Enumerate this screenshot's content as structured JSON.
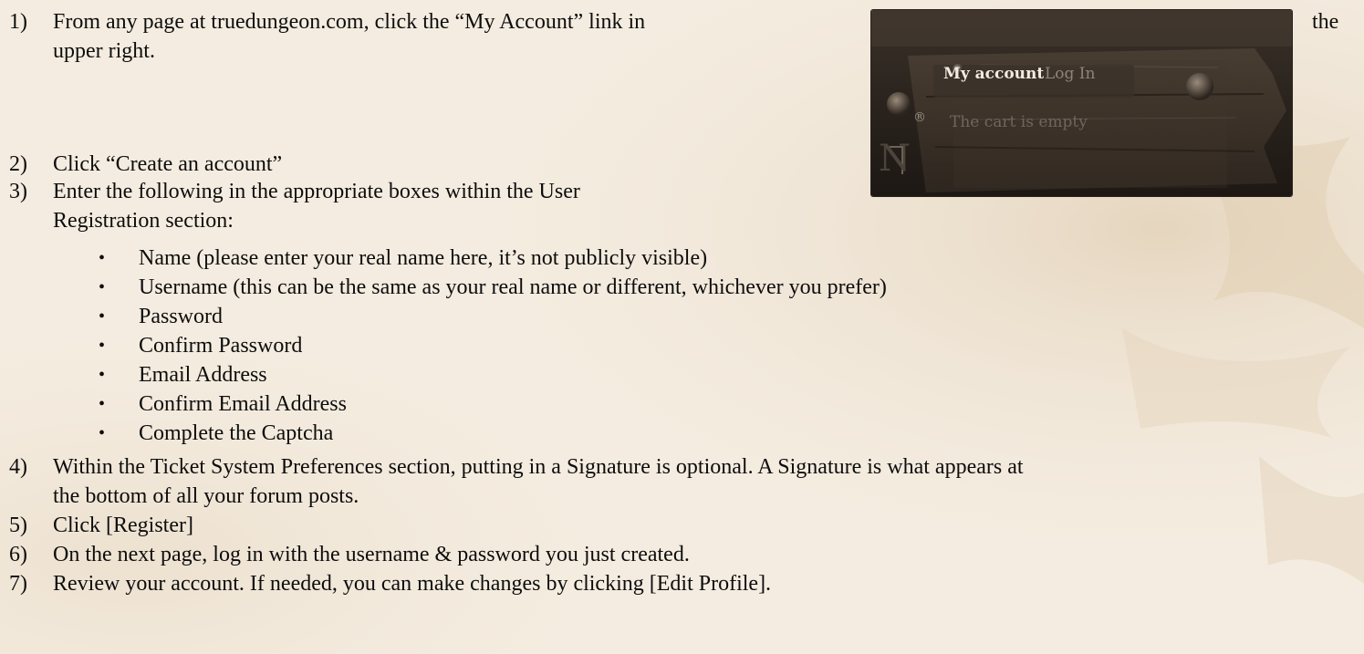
{
  "steps": [
    {
      "num": "1)",
      "line1": "From any page at truedungeon.com, click the “My Account” link in",
      "line1_end": "the",
      "line2": "upper right."
    },
    {
      "num": "2)",
      "line1": "Click “Create an account”"
    },
    {
      "num": "3)",
      "line1": "Enter the following in the appropriate boxes within the User",
      "line2": "Registration section:"
    },
    {
      "num": "4)",
      "line1": "Within the Ticket System Preferences section, putting in a Signature is optional. A Signature is what appears at",
      "line2": "the bottom of all your forum posts."
    },
    {
      "num": "5)",
      "line1": "Click [Register]"
    },
    {
      "num": "6)",
      "line1": "On the next page, log in with the username & password you just created."
    },
    {
      "num": "7)",
      "line1": "Review your account. If needed, you can make changes by clicking [Edit Profile]."
    }
  ],
  "bullets": [
    "Name (please enter your real name here, it’s not publicly visible)",
    "Username (this can be the same as your real name or different, whichever you prefer)",
    "Password",
    "Confirm Password",
    "Email Address",
    "Confirm Email Address",
    "Complete the Captcha"
  ],
  "bullet_glyph": "•",
  "screenshot": {
    "my_account": "My account",
    "log_in": "Log In",
    "cart": "The cart is empty",
    "registered_mark": "®",
    "logo_letter": "N"
  },
  "colors": {
    "page_bg": "#f4ece0",
    "parchment_shade": "#e6d6bf",
    "wood_dark": "#2b231c",
    "wood_mid": "#4a3d31",
    "label_active": "#f2ece2",
    "label_muted": "#8f8478"
  }
}
